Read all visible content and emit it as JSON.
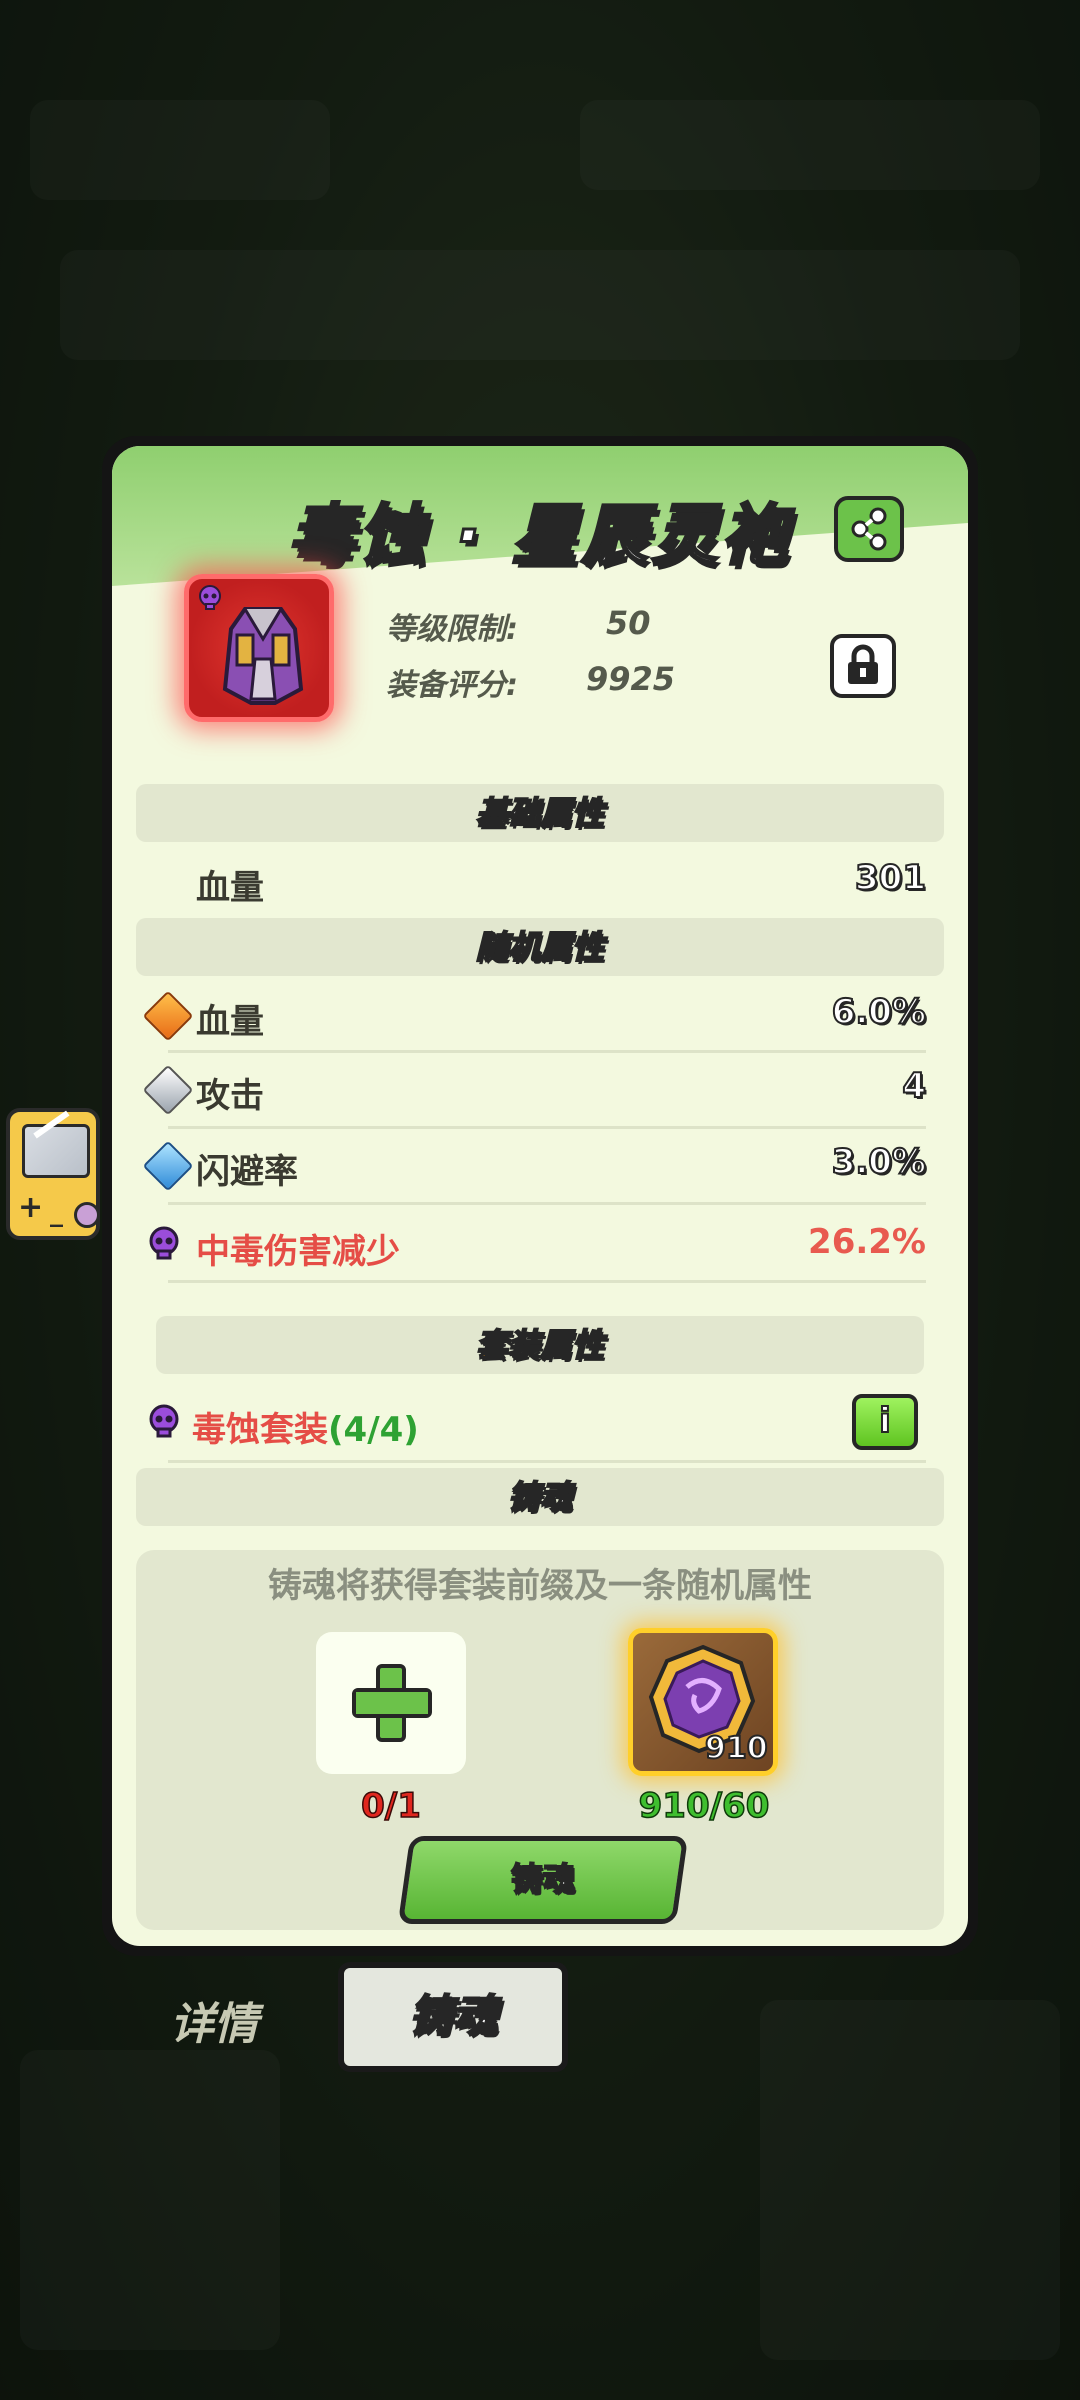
{
  "item": {
    "name": "毒蚀 · 星辰灵袍",
    "level_label": "等级限制:",
    "level_value": "50",
    "score_label": "装备评分:",
    "score_value": "9925"
  },
  "sections": {
    "base": "基础属性",
    "random": "随机属性",
    "set": "套装属性",
    "forge": "铸魂"
  },
  "base_attrs": [
    {
      "label": "血量",
      "value": "301"
    }
  ],
  "random_attrs": [
    {
      "icon": "orange-gem-icon",
      "label": "血量",
      "value": "6.0%"
    },
    {
      "icon": "silver-gem-icon",
      "label": "攻击",
      "value": "4"
    },
    {
      "icon": "blue-gem-icon",
      "label": "闪避率",
      "value": "3.0%"
    },
    {
      "icon": "poison-skull-icon",
      "label": "中毒伤害减少",
      "value": "26.2%"
    }
  ],
  "set_bonus": {
    "name": "毒蚀套装",
    "count": "(4/4)"
  },
  "forge": {
    "description": "铸魂将获得套装前缀及一条随机属性",
    "slot_requirement": "0/1",
    "material_count": "910",
    "material_requirement": "910/60",
    "button_label": "铸魂"
  },
  "tabs": [
    {
      "label": "详情",
      "active": false
    },
    {
      "label": "铸魂",
      "active": true
    }
  ],
  "colors": {
    "panel_bg": "#f3f9df",
    "header_green": "#8fcf6f",
    "accent_red": "#e54d46",
    "accent_green": "#3fbe2f",
    "set_orange": "#f39a1c"
  }
}
